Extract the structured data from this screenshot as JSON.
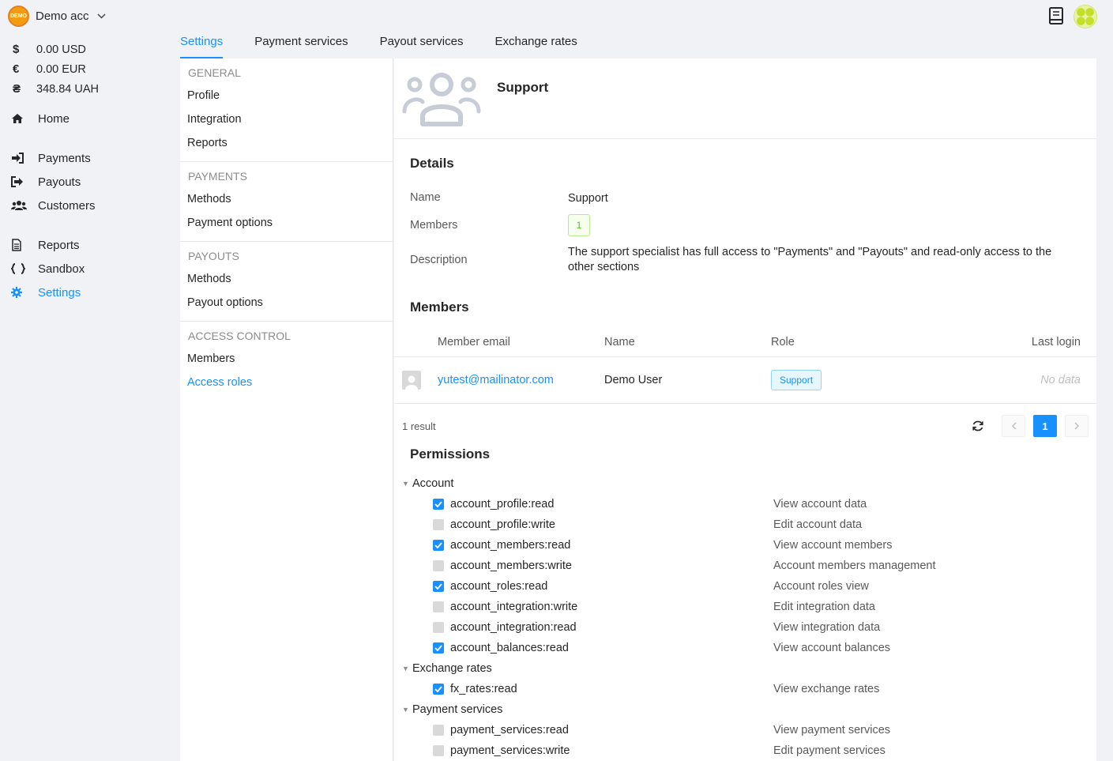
{
  "account": {
    "logo_text": "DEMO",
    "name": "Demo acc"
  },
  "balances": [
    {
      "symbol": "$",
      "value": "0.00 USD"
    },
    {
      "symbol": "€",
      "value": "0.00 EUR"
    },
    {
      "symbol": "₴",
      "value": "348.84 UAH"
    }
  ],
  "nav": {
    "home": "Home",
    "payments": "Payments",
    "payouts": "Payouts",
    "customers": "Customers",
    "reports": "Reports",
    "sandbox": "Sandbox",
    "settings": "Settings"
  },
  "tabs": [
    "Settings",
    "Payment services",
    "Payout services",
    "Exchange rates"
  ],
  "settings_menu": {
    "general": {
      "title": "GENERAL",
      "items": [
        "Profile",
        "Integration",
        "Reports"
      ]
    },
    "payments": {
      "title": "PAYMENTS",
      "items": [
        "Methods",
        "Payment options"
      ]
    },
    "payouts": {
      "title": "PAYOUTS",
      "items": [
        "Methods",
        "Payout options"
      ]
    },
    "access": {
      "title": "ACCESS CONTROL",
      "items": [
        "Members",
        "Access roles"
      ]
    }
  },
  "role": {
    "title": "Support",
    "details_title": "Details",
    "name_label": "Name",
    "name_value": "Support",
    "members_label": "Members",
    "members_count": "1",
    "description_label": "Description",
    "description_value": "The support specialist has full access to \"Payments\" and \"Payouts\" and read-only access to the other sections"
  },
  "members": {
    "title": "Members",
    "columns": [
      "Member email",
      "Name",
      "Role",
      "Last login"
    ],
    "rows": [
      {
        "email": "yutest@mailinator.com",
        "name": "Demo User",
        "role": "Support",
        "last_login": "No data"
      }
    ],
    "result_text": "1 result",
    "current_page": "1"
  },
  "permissions": {
    "title": "Permissions",
    "groups": [
      {
        "name": "Account",
        "items": [
          {
            "key": "account_profile:read",
            "desc": "View account data",
            "checked": true
          },
          {
            "key": "account_profile:write",
            "desc": "Edit account data",
            "checked": false
          },
          {
            "key": "account_members:read",
            "desc": "View account members",
            "checked": true
          },
          {
            "key": "account_members:write",
            "desc": "Account members management",
            "checked": false
          },
          {
            "key": "account_roles:read",
            "desc": "Account roles view",
            "checked": true
          },
          {
            "key": "account_integration:write",
            "desc": "Edit integration data",
            "checked": false
          },
          {
            "key": "account_integration:read",
            "desc": "View integration data",
            "checked": false
          },
          {
            "key": "account_balances:read",
            "desc": "View account balances",
            "checked": true
          }
        ]
      },
      {
        "name": "Exchange rates",
        "items": [
          {
            "key": "fx_rates:read",
            "desc": "View exchange rates",
            "checked": true
          }
        ]
      },
      {
        "name": "Payment services",
        "items": [
          {
            "key": "payment_services:read",
            "desc": "View payment services",
            "checked": false
          },
          {
            "key": "payment_services:write",
            "desc": "Edit payment services",
            "checked": false
          }
        ]
      }
    ]
  },
  "colors": {
    "accent": "#1890ff",
    "success": "#52c41a",
    "muted": "#8c8c8c"
  }
}
